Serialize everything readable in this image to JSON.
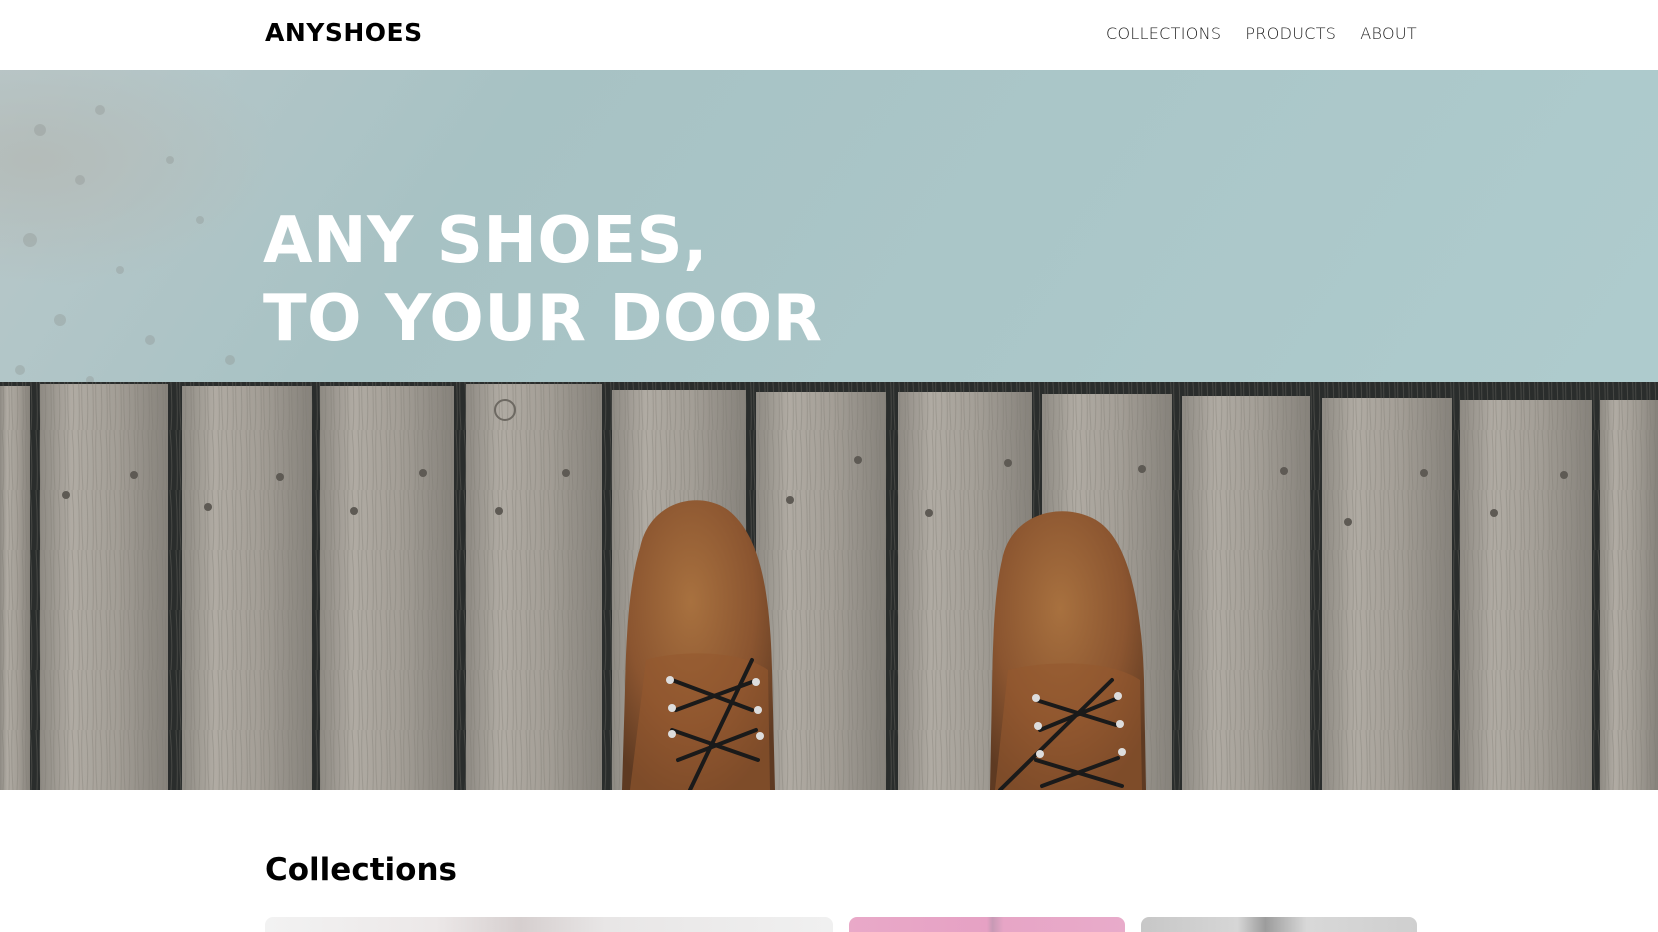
{
  "header": {
    "logo": "ANYSHOES",
    "nav": [
      "COLLECTIONS",
      "PRODUCTS",
      "ABOUT"
    ]
  },
  "hero": {
    "title_line1": "ANY SHOES,",
    "title_line2": "TO YOUR DOOR"
  },
  "collections": {
    "title": "Collections"
  },
  "colors": {
    "water": "#a9c6c8",
    "boardwalk": "#9a958d",
    "boot": "#8f5a35"
  }
}
